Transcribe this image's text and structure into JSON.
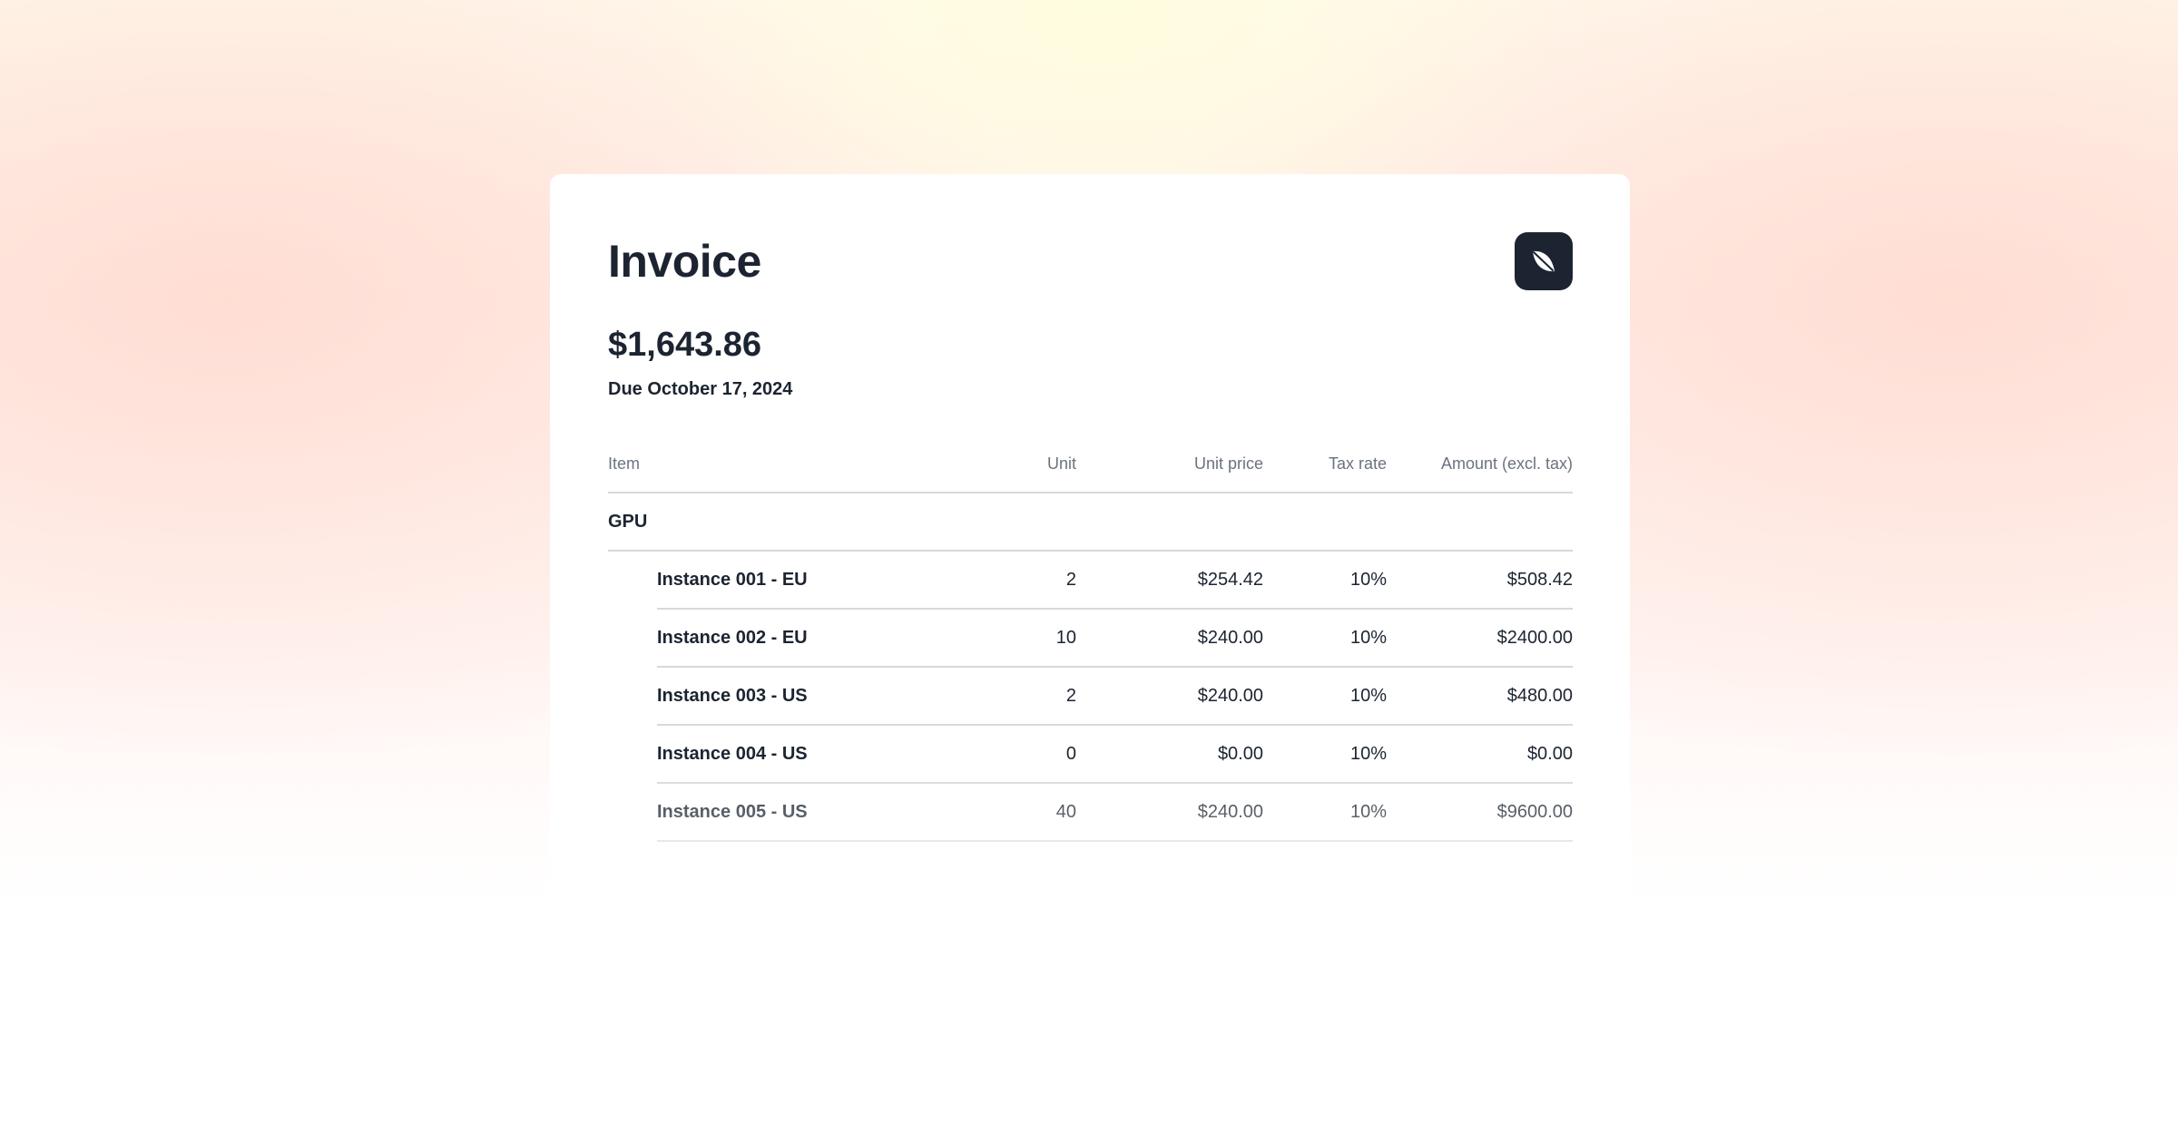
{
  "invoice": {
    "title": "Invoice",
    "total": "$1,643.86",
    "due": "Due October 17, 2024"
  },
  "logo": {
    "icon": "leaf-icon",
    "color": "#1c2431"
  },
  "table": {
    "headers": {
      "item": "Item",
      "unit": "Unit",
      "unit_price": "Unit price",
      "tax_rate": "Tax rate",
      "amount": "Amount (excl. tax)"
    },
    "group": {
      "name": "GPU",
      "rows": [
        {
          "name": "Instance 001 - EU",
          "unit": "2",
          "unit_price": "$254.42",
          "tax_rate": "10%",
          "amount": "$508.42"
        },
        {
          "name": "Instance 002 - EU",
          "unit": "10",
          "unit_price": "$240.00",
          "tax_rate": "10%",
          "amount": "$2400.00"
        },
        {
          "name": "Instance 003 - US",
          "unit": "2",
          "unit_price": "$240.00",
          "tax_rate": "10%",
          "amount": "$480.00"
        },
        {
          "name": "Instance 004 - US",
          "unit": "0",
          "unit_price": "$0.00",
          "tax_rate": "10%",
          "amount": "$0.00"
        },
        {
          "name": "Instance 005 - US",
          "unit": "40",
          "unit_price": "$240.00",
          "tax_rate": "10%",
          "amount": "$9600.00"
        }
      ]
    }
  }
}
